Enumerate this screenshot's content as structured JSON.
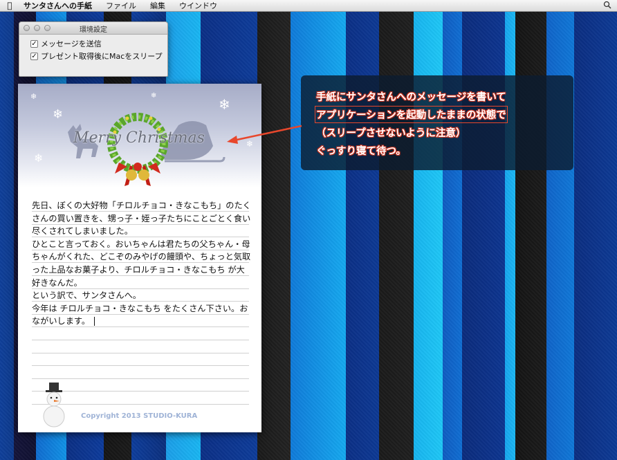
{
  "menubar": {
    "app_name": "サンタさんへの手紙",
    "items": [
      "ファイル",
      "編集",
      "ウインドウ"
    ],
    "right_icon": "search-icon"
  },
  "prefs": {
    "title": "環境設定",
    "options": [
      {
        "label": "メッセージを送信",
        "checked": true
      },
      {
        "label": "プレゼント取得後にMacをスリープ",
        "checked": true
      }
    ]
  },
  "letter": {
    "header_title": "Merry Christmas",
    "lines": [
      "先日、ぼくの大好物「チロルチョコ・きなこもち」のたく",
      "さんの買い置きを、甥っ子・姪っ子たちにことごとく食い",
      "尽くされてしまいました。",
      "ひとこと言っておく。おいちゃんは君たちの父ちゃん・母",
      "ちゃんがくれた、どこぞのみやげの饅頭や、ちょっと気取",
      "った上品なお菓子より、チロルチョコ・きなこもち が大",
      "好きなんだ。",
      "という訳で、サンタさんへ。",
      "今年は チロルチョコ・きなこもち をたくさん下さい。お",
      "ながいします。"
    ],
    "copyright": "Copyright 2013 STUDIO-KURA"
  },
  "annotation": {
    "lines": [
      "手紙にサンタさんへのメッセージを書いて",
      "アプリケーションを起動したままの状態で",
      "（スリープさせないように注意）",
      "ぐっすり寝て待つ。"
    ],
    "accent": "#e8472c"
  }
}
